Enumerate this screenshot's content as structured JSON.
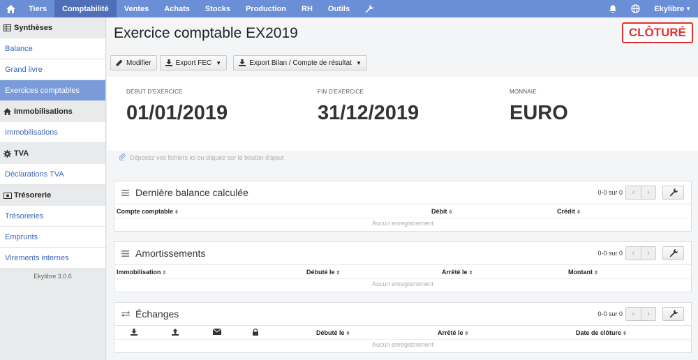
{
  "topnav": {
    "items": [
      "Tiers",
      "Comptabilité",
      "Ventes",
      "Achats",
      "Stocks",
      "Production",
      "RH",
      "Outils"
    ],
    "active": "Comptabilité",
    "user": "Ekylibre"
  },
  "sidebar": {
    "sections": [
      {
        "title": "Synthèses",
        "icon": "table-icon",
        "items": [
          "Balance",
          "Grand livre",
          "Exercices comptables"
        ]
      },
      {
        "title": "Immobilisations",
        "icon": "home-icon",
        "items": [
          "Immobilisations"
        ]
      },
      {
        "title": "TVA",
        "icon": "gear-icon",
        "items": [
          "Déclarations TVA"
        ]
      },
      {
        "title": "Trésorerie",
        "icon": "money-icon",
        "items": [
          "Trésoreries",
          "Emprunts",
          "Virements internes"
        ]
      }
    ],
    "active_item": "Exercices comptables",
    "version": "Ekylibre 3.0.6"
  },
  "page": {
    "title": "Exercice comptable EX2019",
    "status_badge": "CLÔTURÉ",
    "buttons": {
      "edit": "Modifier",
      "export_fec": "Export FEC",
      "export_bilan": "Export Bilan / Compte de résultat"
    },
    "info": {
      "start_label": "DÉBUT D'EXERCICE",
      "start_value": "01/01/2019",
      "end_label": "FIN D'EXERCICE",
      "end_value": "31/12/2019",
      "currency_label": "MONNAIE",
      "currency_value": "EURO"
    },
    "dropzone": "Déposez vos fichiers ici ou cliquez sur le bouton d'ajout"
  },
  "cards": {
    "balance": {
      "title": "Dernière balance calculée",
      "pager": "0-0 sur 0",
      "columns": [
        "Compte comptable",
        "Débit",
        "Crédit"
      ],
      "empty": "Aucun enregistrement"
    },
    "amortissements": {
      "title": "Amortissements",
      "pager": "0-0 sur 0",
      "columns": [
        "Immobilisation",
        "Débuté le",
        "Arrêté le",
        "Montant"
      ],
      "empty": "Aucun enregistrement"
    },
    "echanges": {
      "title": "Échanges",
      "pager": "0-0 sur 0",
      "icon_columns": [
        "download-icon",
        "upload-icon",
        "envelope-icon",
        "lock-icon"
      ],
      "columns": [
        "Débuté le",
        "Arrêté le",
        "Date de clôture"
      ],
      "empty": "Aucun enregistrement"
    }
  },
  "colors": {
    "nav_bg": "#6b8fd6",
    "nav_active": "#4f6fb8",
    "sidebar_active": "#7a9bd9",
    "link": "#3a66b8",
    "badge": "#e03030"
  }
}
